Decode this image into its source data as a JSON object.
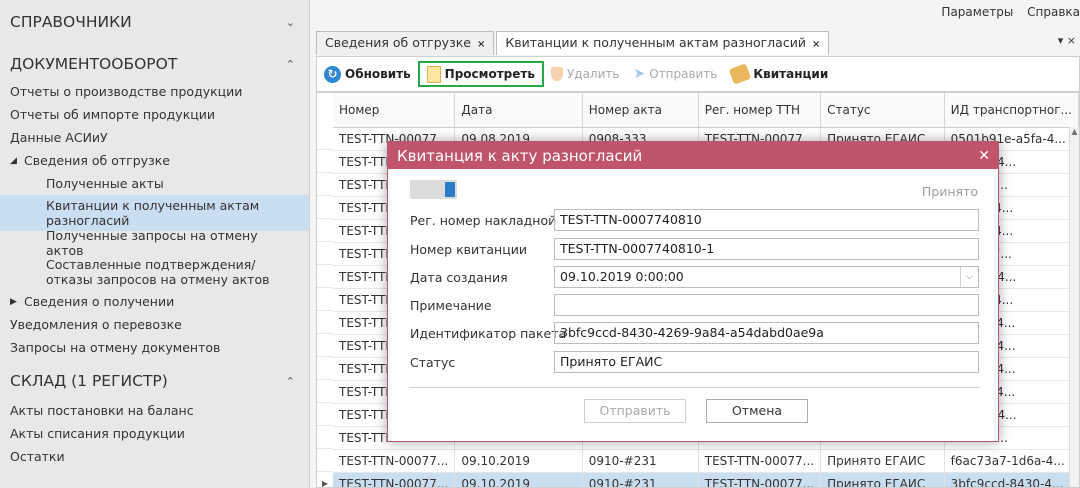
{
  "sidebar": {
    "sections": [
      {
        "title": "СПРАВОЧНИКИ",
        "chevron": "chevron-down"
      },
      {
        "title": "ДОКУМЕНТООБОРОТ",
        "chevron": "chevron-up"
      },
      {
        "title": "СКЛАД (1 РЕГИСТР)",
        "chevron": "chevron-up"
      }
    ],
    "docflow_items": [
      "Отчеты о производстве продукции",
      "Отчеты об импорте продукции",
      "Данные АСИиУ",
      "Сведения об отгрузке",
      "Полученные акты",
      "Квитанции к полученным актам разногласий",
      "Полученные запросы на отмену актов",
      "Составленные подтверждения/отказы запросов на отмену актов",
      "Сведения о получении",
      "Уведомления о перевозке",
      "Запросы на отмену документов"
    ],
    "warehouse_items": [
      "Акты постановки на баланс",
      "Акты списания продукции",
      "Остатки"
    ]
  },
  "topmenu": {
    "params": "Параметры",
    "help": "Справка"
  },
  "tabs": [
    {
      "label": "Сведения об отгрузке",
      "close": "×"
    },
    {
      "label": "Квитанции к полученным актам разногласий",
      "close": "×"
    }
  ],
  "tab_tools": "▾ ×",
  "toolbar": {
    "refresh": "Обновить",
    "view": "Просмотреть",
    "delete": "Удалить",
    "send": "Отправить",
    "receipts": "Квитанции"
  },
  "grid": {
    "columns": [
      "Номер",
      "Дата",
      "Номер акта",
      "Рег. номер ТТН",
      "Статус",
      "ИД транспортног..."
    ],
    "rows": [
      [
        "TEST-TTN-00077...",
        "09.08.2019",
        "0908-333",
        "TEST-TTN-00077...",
        "Принято ЕГАИС",
        "0501b91e-a5fa-4..."
      ],
      [
        "TEST-TTN",
        "",
        "",
        "",
        "",
        "e-73e7-4..."
      ],
      [
        "TEST-TTN",
        "",
        "",
        "",
        "",
        "d-7bbc-..."
      ],
      [
        "TEST-TTN",
        "",
        "",
        "",
        "",
        "5-f34d-4..."
      ],
      [
        "TEST-TTN",
        "",
        "",
        "",
        "",
        "0-f90d-4..."
      ],
      [
        "TEST-TTN",
        "",
        "",
        "",
        "",
        "-c6fe-47..."
      ],
      [
        "TEST-TTN",
        "",
        "",
        "",
        "",
        "e-4621-4..."
      ],
      [
        "TEST-TTN",
        "",
        "",
        "",
        "",
        "b-7f10-4..."
      ],
      [
        "TEST-TTN",
        "",
        "",
        "",
        "",
        "5-9e7c-4..."
      ],
      [
        "TEST-TTN",
        "",
        "",
        "",
        "",
        "2-6d8c-4..."
      ],
      [
        "TEST-TTN",
        "",
        "",
        "",
        "",
        "c-9206-4..."
      ],
      [
        "TEST-TTN",
        "",
        "",
        "",
        "",
        "b-ad0c-4..."
      ],
      [
        "TEST-TTN",
        "",
        "",
        "",
        "",
        "1-8069-4..."
      ],
      [
        "TEST-TTN",
        "",
        "",
        "",
        "",
        "-c856-4..."
      ],
      [
        "TEST-TTN-00077...",
        "09.10.2019",
        "0910-#231",
        "TEST-TTN-00077...",
        "Принято ЕГАИС",
        "f6ac73a7-1d6a-4..."
      ],
      [
        "TEST-TTN-00077...",
        "09.10.2019",
        "0910-#231",
        "TEST-TTN-00077...",
        "Принято ЕГАИС",
        "3bfc9ccd-8430-4..."
      ]
    ]
  },
  "modal": {
    "title": "Квитанция к акту разногласий",
    "status_top": "Принято",
    "fields": {
      "reg_number_label": "Рег. номер накладной",
      "reg_number_value": "TEST-TTN-0007740810",
      "receipt_number_label": "Номер квитанции",
      "receipt_number_value": "TEST-TTN-0007740810-1",
      "created_label": "Дата создания",
      "created_value": "09.10.2019 0:00:00",
      "note_label": "Примечание",
      "note_value": "",
      "package_label": "Идентификатор пакета",
      "package_value": "3bfc9ccd-8430-4269-9a84-a54dabd0ae9a",
      "status_label": "Статус",
      "status_value": "Принято ЕГАИС"
    },
    "send_button": "Отправить",
    "cancel_button": "Отмена"
  },
  "colors": {
    "modal_header": "#c0546a",
    "selection": "#cadef2",
    "highlight_border": "#27a745"
  }
}
